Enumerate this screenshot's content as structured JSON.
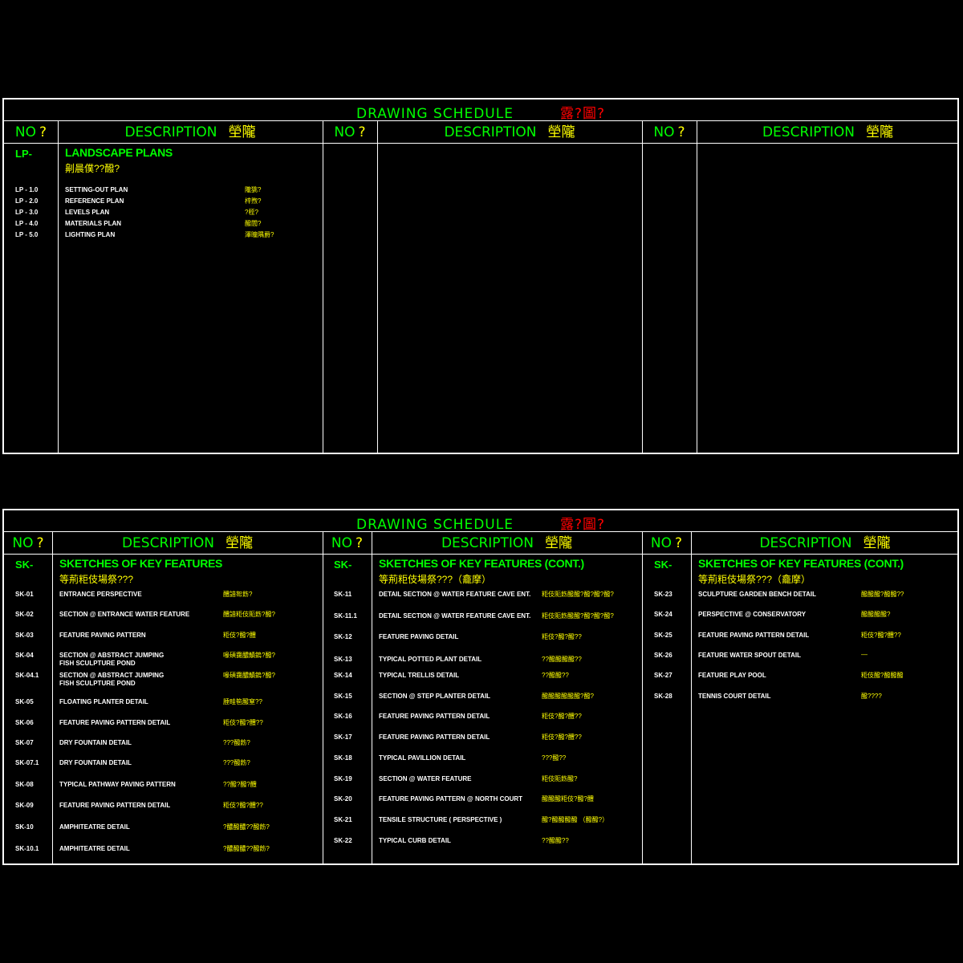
{
  "schedule_title": "DRAWING SCHEDULE",
  "schedule_title_cn": "露?圖?",
  "col_no": "NO",
  "col_no_mark": "?",
  "col_desc": "DESCRIPTION",
  "col_desc_cn": "塋隴",
  "top": {
    "col1": {
      "code": "LP-",
      "title": "LANDSCAPE PLANS",
      "subtitle": "劓晨僕??醱?",
      "items": [
        {
          "code": "LP - 1.0",
          "desc": "SETTING-OUT PLAN",
          "cn": "隴狣?"
        },
        {
          "code": "LP - 2.0",
          "desc": "REFERENCE PLAN",
          "cn": "梓煦?"
        },
        {
          "code": "LP - 3.0",
          "desc": "LEVELS PLAN",
          "cn": "?秷?"
        },
        {
          "code": "LP - 4.0",
          "desc": "MATERIALS PLAN",
          "cn": "醱閭?"
        },
        {
          "code": "LP - 5.0",
          "desc": "LIGHTING PLAN",
          "cn": "澤瞳隅爵?"
        }
      ]
    }
  },
  "bottom": {
    "col1": {
      "code": "SK-",
      "title": "SKETCHES OF KEY FEATURES",
      "subtitle": "等荊粔伎場祭???",
      "items": [
        {
          "code": "SK-01",
          "desc": "ENTRANCE PERSPECTIVE",
          "cn": "醴諳帤飭?"
        },
        {
          "code": "SK-02",
          "desc": "SECTION @ ENTRANCE WATER FEATURE",
          "cn": "醴諳粔伎阨飭?醱?"
        },
        {
          "code": "SK-03",
          "desc": "FEATURE PAVING PATTERN",
          "cn": "粔伎?醱?醴"
        },
        {
          "code": "SK-04",
          "desc": "SECTION @ ABSTRACT JUMPING",
          "desc2": "FISH SCULPTURE POND",
          "cn": "喙碩靄醲鰿鎢?醱?"
        },
        {
          "code": "SK-04.1",
          "desc": "SECTION @ ABSTRACT JUMPING",
          "desc2": "FISH SCULPTURE POND",
          "cn": "喙碩靄醲鰿鎢?醱?"
        },
        {
          "code": "SK-05",
          "desc": "FLOATING PLANTER DETAIL",
          "cn": "腄畦笣醱窒??"
        },
        {
          "code": "SK-06",
          "desc": "FEATURE PAVING PATTERN DETAIL",
          "cn": "粔伎?醱?醴??"
        },
        {
          "code": "SK-07",
          "desc": "DRY FOUNTAIN DETAIL",
          "cn": "???醱飭?"
        },
        {
          "code": "SK-07.1",
          "desc": "DRY FOUNTAIN DETAIL",
          "cn": "???醱飭?"
        },
        {
          "code": "SK-08",
          "desc": "TYPICAL PATHWAY PAVING PATTERN",
          "cn": "??醱?醱?醴"
        },
        {
          "code": "SK-09",
          "desc": "FEATURE PAVING PATTERN DETAIL",
          "cn": "粔伎?醱?醴??"
        },
        {
          "code": "SK-10",
          "desc": "AMPHITEATRE DETAIL",
          "cn": "?醲醱醲??醱飭?"
        },
        {
          "code": "SK-10.1",
          "desc": "AMPHITEATRE DETAIL",
          "cn": "?醲醱醲??醱飭?"
        }
      ]
    },
    "col2": {
      "code": "SK-",
      "title": "SKETCHES OF KEY FEATURES (CONT.)",
      "subtitle": "等荊粔伎場祭???（龕摩）",
      "items": [
        {
          "code": "SK-11",
          "desc": "DETAIL SECTION @ WATER FEATURE CAVE ENT.",
          "cn": "粔伎阨飭醱醱?醱?醱?醱?"
        },
        {
          "code": "SK-11.1",
          "desc": "DETAIL SECTION @ WATER FEATURE CAVE ENT.",
          "cn": "粔伎阨飭醱醱?醱?醱?醱?"
        },
        {
          "code": "SK-12",
          "desc": "FEATURE PAVING DETAIL",
          "cn": "粔伎?醱?醱??"
        },
        {
          "code": "SK-13",
          "desc": "TYPICAL POTTED PLANT DETAIL",
          "cn": "??醱醱醱醱??"
        },
        {
          "code": "SK-14",
          "desc": "TYPICAL TRELLIS DETAIL",
          "cn": "??醱醱??"
        },
        {
          "code": "SK-15",
          "desc": "SECTION @ STEP PLANTER DETAIL",
          "cn": "醱醱醱醱醱醱?醱?"
        },
        {
          "code": "SK-16",
          "desc": "FEATURE PAVING PATTERN DETAIL",
          "cn": "粔伎?醱?醴??"
        },
        {
          "code": "SK-17",
          "desc": "FEATURE PAVING PATTERN DETAIL",
          "cn": "粔伎?醱?醴??"
        },
        {
          "code": "SK-18",
          "desc": "TYPICAL PAVILLION DETAIL",
          "cn": "???醱??"
        },
        {
          "code": "SK-19",
          "desc": "SECTION @ WATER FEATURE",
          "cn": "粔伎阨飭醱?"
        },
        {
          "code": "SK-20",
          "desc": "FEATURE PAVING PATTERN @ NORTH COURT",
          "cn": "醱醱醱粔伎?醱?醴"
        },
        {
          "code": "SK-21",
          "desc": "TENSILE STRUCTURE ( PERSPECTIVE )",
          "cn": "醱?醱醱醱醱 （醱醱?）"
        },
        {
          "code": "SK-22",
          "desc": "TYPICAL CURB DETAIL",
          "cn": "??醱醱??"
        }
      ]
    },
    "col3": {
      "code": "SK-",
      "title": "SKETCHES OF KEY FEATURES (CONT.)",
      "subtitle": "等荊粔伎場祭???（龕摩）",
      "items": [
        {
          "code": "SK-23",
          "desc": "SCULPTURE GARDEN BENCH DETAIL",
          "cn": "醱醱醱?醱醱??"
        },
        {
          "code": "SK-24",
          "desc": "PERSPECTIVE @ CONSERVATORY",
          "cn": "醱醱醱醱?"
        },
        {
          "code": "SK-25",
          "desc": "FEATURE PAVING PATTERN DETAIL",
          "cn": "粔伎?醱?醴??"
        },
        {
          "code": "SK-26",
          "desc": "FEATURE WATER SPOUT DETAIL",
          "cn": "—"
        },
        {
          "code": "SK-27",
          "desc": "FEATURE PLAY POOL",
          "cn": "粔伎醱?醱醱醱"
        },
        {
          "code": "SK-28",
          "desc": "TENNIS COURT DETAIL",
          "cn": "醱????"
        }
      ]
    }
  }
}
